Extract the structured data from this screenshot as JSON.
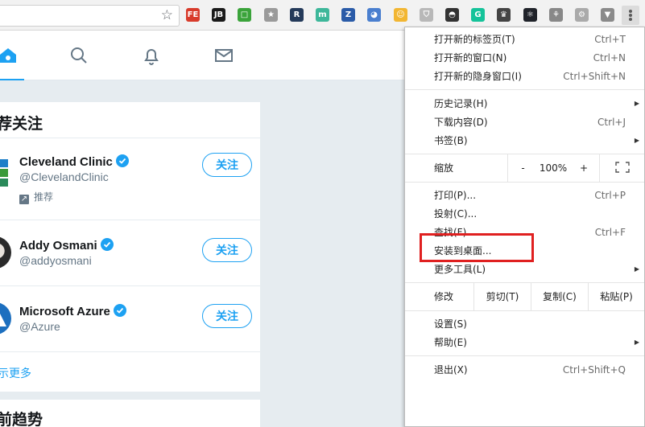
{
  "toolbar": {
    "bookmark_icon": "star-icon",
    "extensions": [
      {
        "name": "fe-extension-icon",
        "text": "FE",
        "color": "#d83b2b"
      },
      {
        "name": "jetbrains-extension-icon",
        "text": "JB",
        "color": "#1a1a1a"
      },
      {
        "name": "green-square-extension-icon",
        "text": "□",
        "color": "#3aa33a"
      },
      {
        "name": "star-extension-icon",
        "text": "★",
        "color": "#9a9a9a"
      },
      {
        "name": "r-extension-icon",
        "text": "R",
        "color": "#243a5a"
      },
      {
        "name": "m-extension-icon",
        "text": "m",
        "color": "#3db79a"
      },
      {
        "name": "z-extension-icon",
        "text": "Z",
        "color": "#2a5ba8"
      },
      {
        "name": "blue-circle-extension-icon",
        "text": "◕",
        "color": "#4a7fcf"
      },
      {
        "name": "smiley-extension-icon",
        "text": "☺",
        "color": "#f2b632"
      },
      {
        "name": "shield-extension-icon",
        "text": "⛉",
        "color": "#b8b8b8"
      },
      {
        "name": "mask-extension-icon",
        "text": "◓",
        "color": "#333333"
      },
      {
        "name": "grammarly-extension-icon",
        "text": "G",
        "color": "#15c39a"
      },
      {
        "name": "spy-extension-icon",
        "text": "♛",
        "color": "#444444"
      },
      {
        "name": "react-extension-icon",
        "text": "⚛",
        "color": "#20232a"
      },
      {
        "name": "graph-extension-icon",
        "text": "⚘",
        "color": "#888888"
      },
      {
        "name": "gear-extension-icon",
        "text": "⚙",
        "color": "#aaaaaa"
      },
      {
        "name": "vue-extension-icon",
        "text": "▼",
        "color": "#8a8a8a"
      }
    ],
    "menu_icon": "kebab-menu-icon"
  },
  "twitter": {
    "colors": {
      "accent": "#1da1f2",
      "verified": "#1da1f2"
    },
    "nav": [
      {
        "name": "home-tab",
        "icon": "home-icon"
      },
      {
        "name": "search-tab",
        "icon": "search-icon"
      },
      {
        "name": "notifications-tab",
        "icon": "bell-icon"
      },
      {
        "name": "messages-tab",
        "icon": "mail-icon"
      }
    ],
    "recommend": {
      "title": "荐关注",
      "users": [
        {
          "name": "Cleveland Clinic",
          "handle": "@ClevelandClinic",
          "promoted": "推荐",
          "follow": "关注"
        },
        {
          "name": "Addy Osmani",
          "handle": "@addyosmani",
          "follow": "关注"
        },
        {
          "name": "Microsoft Azure",
          "handle": "@Azure",
          "follow": "关注"
        }
      ],
      "show_more": "示更多"
    },
    "trends": {
      "title": "前趋势"
    }
  },
  "menu": {
    "new_tab": {
      "label": "打开新的标签页(T)",
      "shortcut": "Ctrl+T"
    },
    "new_window": {
      "label": "打开新的窗口(N)",
      "shortcut": "Ctrl+N"
    },
    "incognito": {
      "label": "打开新的隐身窗口(I)",
      "shortcut": "Ctrl+Shift+N"
    },
    "history": {
      "label": "历史记录(H)"
    },
    "downloads": {
      "label": "下载内容(D)",
      "shortcut": "Ctrl+J"
    },
    "bookmarks": {
      "label": "书签(B)"
    },
    "zoom": {
      "label": "缩放",
      "minus": "-",
      "value": "100%",
      "plus": "+"
    },
    "print": {
      "label": "打印(P)...",
      "shortcut": "Ctrl+P"
    },
    "cast": {
      "label": "投射(C)..."
    },
    "find": {
      "label": "查找(F)...",
      "shortcut": "Ctrl+F"
    },
    "install": {
      "label": "安装到桌面..."
    },
    "more_tools": {
      "label": "更多工具(L)"
    },
    "edit": {
      "label": "修改",
      "cut": "剪切(T)",
      "copy": "复制(C)",
      "paste": "粘贴(P)"
    },
    "settings": {
      "label": "设置(S)"
    },
    "help": {
      "label": "帮助(E)"
    },
    "exit": {
      "label": "退出(X)",
      "shortcut": "Ctrl+Shift+Q"
    },
    "highlight_color": "#e02020"
  }
}
